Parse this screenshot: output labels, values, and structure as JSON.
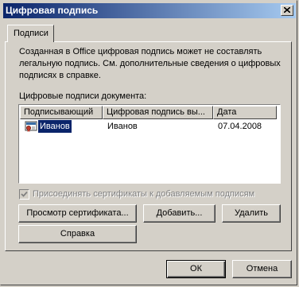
{
  "window": {
    "title": "Цифровая подпись"
  },
  "tabs": [
    {
      "label": "Подписи"
    }
  ],
  "description": "Созданная в Office цифровая подпись может не составлять легальную подпись. См. дополнительные сведения о цифровых подписях в справке.",
  "list": {
    "label": "Цифровые подписи документа:",
    "columns": [
      "Подписывающий",
      "Цифровая подпись вы...",
      "Дата"
    ],
    "rows": [
      {
        "signer": "Иванов",
        "issued_by": "Иванов",
        "date": "07.04.2008",
        "icon": "certificate-icon",
        "selected": true
      }
    ]
  },
  "checkbox": {
    "label": "Присоединять сертификаты к добавляемым подписям",
    "checked": true,
    "disabled": true
  },
  "buttons": {
    "view_certificate": "Просмотр сертификата...",
    "add": "Добавить...",
    "remove": "Удалить",
    "help": "Справка",
    "ok": "ОК",
    "cancel": "Отмена"
  },
  "colors": {
    "titlebar_start": "#0a246a",
    "titlebar_end": "#a6caf0",
    "selection": "#0a246a",
    "face": "#d4d0c8"
  }
}
